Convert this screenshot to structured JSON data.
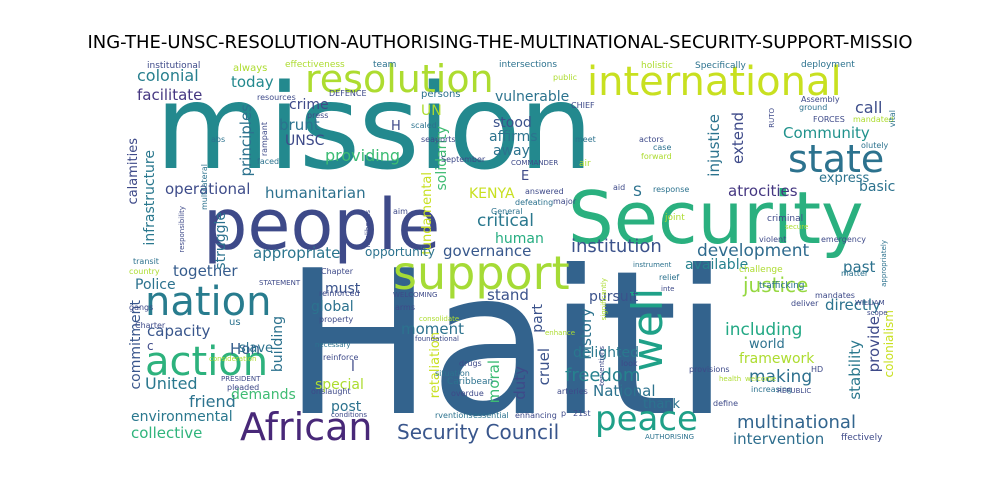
{
  "title": "ING-THE-UNSC-RESOLUTION-AUTHORISING-THE-MULTINATIONAL-SECURITY-SUPPORT-MISSIO",
  "words": {
    "haiti": "Haiti",
    "mission": "mission",
    "security": "Security",
    "people": "people",
    "support": "support",
    "international": "international",
    "resolution": "resolution",
    "state": "state",
    "nation": "nation",
    "action": "action",
    "african": "African",
    "peace": "peace",
    "well": "well",
    "security_council": "Security Council",
    "multinational": "multinational",
    "development": "development",
    "institution": "institution",
    "justice": "justice",
    "including": "including",
    "making": "making",
    "freedom": "freedom",
    "humanitarian": "humanitarian",
    "providing": "providing",
    "colonial": "colonial",
    "today": "today",
    "facilitate": "facilitate",
    "operational": "operational",
    "critical": "critical",
    "governance": "governance",
    "human": "human",
    "appropriate": "appropriate",
    "together": "together",
    "capacity": "capacity",
    "united": "United",
    "friend": "friend",
    "hon": "Hon",
    "environmental": "environmental",
    "collective": "collective",
    "demands": "demands",
    "commitment": "commitment",
    "infrastructure": "infrastructure",
    "calamities": "calamities",
    "community": "Community",
    "call": "call",
    "express": "express",
    "basic": "basic",
    "atrocities": "atrocities",
    "extend": "extend",
    "injustice": "injustice",
    "solidarity": "solidarity",
    "vulnerable": "vulnerable",
    "affirms": "affirms",
    "stood": "stood",
    "away": "away",
    "kenya": "KENYA",
    "must": "must",
    "global": "global",
    "moment": "moment",
    "moral": "moral",
    "duty": "duty",
    "cruel": "cruel",
    "history": "history",
    "delighted": "delighted",
    "national": "National",
    "world": "world",
    "framework": "framework",
    "intervention": "intervention",
    "stability": "stability",
    "provide": "provide",
    "directly": "directly",
    "past": "past",
    "available": "available",
    "stand": "stand",
    "pursuit": "pursuit",
    "part": "part",
    "unsc": "UNSC",
    "principles": "principles",
    "brunt": "brunt",
    "crime": "crime",
    "building": "building",
    "struggle": "struggle",
    "post": "post",
    "special": "special",
    "slave": "slave",
    "police": "Police",
    "fundamental": "fundamental",
    "retaliation": "retaliation",
    "thank": "thank",
    "colonialism": "colonialism",
    "opportunity": "opportunity",
    "un": "UN",
    "h_letter": "H",
    "e_letter": "E",
    "s_letter": "S",
    "l_letter": "l",
    "c_letter": "c",
    "institutional": "institutional",
    "team": "team",
    "effectiveness": "effectiveness",
    "intersections": "intersections",
    "holistic": "holistic",
    "specifically": "Specifically",
    "deployment": "deployment",
    "always": "always",
    "defence": "DEFENCE",
    "persons": "persons",
    "public": "public",
    "resources": "resources",
    "press": "press",
    "chief": "CHIEF",
    "assembly": "Assembly",
    "ground": "ground",
    "forces": "FORCES",
    "mandated": "mandated",
    "vital": "vital",
    "ruto": "RUTO",
    "olutely": "olutely",
    "rampant": "rampant",
    "abs": "abs",
    "scaled": "scaled",
    "seaports": "seaports",
    "meet": "meet",
    "case": "case",
    "actors": "actors",
    "forward": "forward",
    "faced": "faced",
    "september": "September",
    "commander": "COMMANDER",
    "air": "air",
    "multilateral": "multilateral",
    "answered": "answered",
    "aid": "aid",
    "response": "response",
    "defeating": "defeating",
    "major": "major",
    "aim": "aim",
    "general": "General",
    "criminal": "criminal",
    "secure": "secure",
    "joint": "joint",
    "livelihoods": "livelihoods",
    "violent": "violent",
    "emergency": "emergency",
    "responsibility": "responsibility",
    "instrument": "instrument",
    "transit": "transit",
    "country": "country",
    "chapter": "Chapter",
    "challenge": "challenge",
    "matter": "matter",
    "appropriately": "appropriately",
    "statement": "STATEMENT",
    "relief": "relief",
    "inte": "inte",
    "trafficking": "trafficking",
    "mandates": "mandates",
    "william": "WILLIAM",
    "scope": "scope",
    "reinforced": "reinforced",
    "welcoming": "WELCOMING",
    "gangs": "gangs",
    "significantly": "significantly",
    "property": "property",
    "arms": "arms",
    "deliver": "deliver",
    "us": "us",
    "consolidate": "consolidate",
    "charter": "Charter",
    "enhance": "enhance",
    "necessary": "necessary",
    "foundational": "foundational",
    "reinforce": "reinforce",
    "consideration": "consideration",
    "president": "PRESIDENT",
    "drugs": "drugs",
    "look": "look",
    "provisions": "provisions",
    "terventions": "terventions",
    "hd": "HD",
    "health": "health",
    "welcome": "welcome",
    "increasing": "increasing",
    "republic": "REPUBLIC",
    "caribbean": "Caribbean",
    "situation": "situation",
    "overdue": "overdue",
    "onslaught": "onslaught",
    "pleaded": "pleaded",
    "arteries": "arteries",
    "conditions": "conditions",
    "rventions": "rventions",
    "essential": "essential",
    "enhancing": "enhancing",
    "p_letter": "p",
    "twentyfirst": "21st",
    "define": "define",
    "authorising": "AUTHORISING",
    "ffectively": "ffectively"
  }
}
